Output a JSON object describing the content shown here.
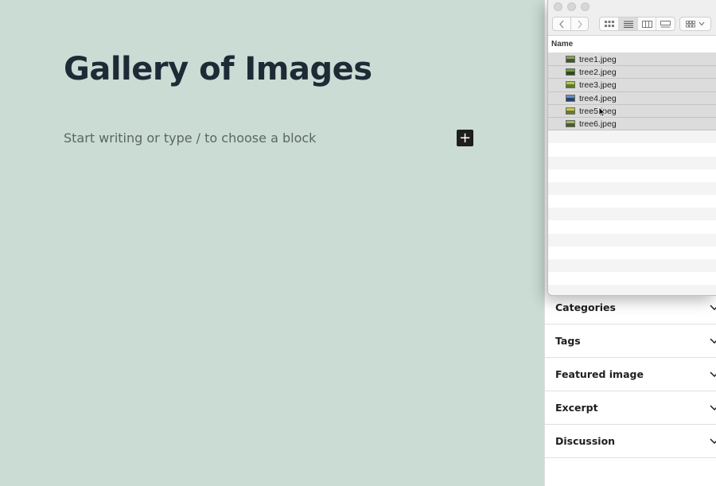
{
  "editor": {
    "post_title": "Gallery of Images",
    "block_placeholder": "Start writing or type / to choose a block",
    "add_block_symbol": "+"
  },
  "sidebar": {
    "panels": [
      {
        "label": "Categories"
      },
      {
        "label": "Tags"
      },
      {
        "label": "Featured image"
      },
      {
        "label": "Excerpt"
      },
      {
        "label": "Discussion"
      }
    ]
  },
  "finder": {
    "column_header": "Name",
    "files": [
      {
        "name": "tree1.jpeg",
        "selected": true,
        "icon": "image-thumbnail-icon",
        "thumb_colors": [
          "#8aa05a",
          "#3d5a2a"
        ]
      },
      {
        "name": "tree2.jpeg",
        "selected": true,
        "icon": "image-thumbnail-icon",
        "thumb_colors": [
          "#6e9a3c",
          "#2f4a1e"
        ]
      },
      {
        "name": "tree3.jpeg",
        "selected": true,
        "icon": "image-thumbnail-icon",
        "thumb_colors": [
          "#b5c94a",
          "#5c7a2a"
        ]
      },
      {
        "name": "tree4.jpeg",
        "selected": true,
        "icon": "image-thumbnail-icon",
        "thumb_colors": [
          "#6a8fc0",
          "#2a3f6a"
        ]
      },
      {
        "name": "tree5.jpeg",
        "selected": true,
        "icon": "image-thumbnail-icon",
        "thumb_colors": [
          "#c8c84a",
          "#6a7a2a"
        ]
      },
      {
        "name": "tree6.jpeg",
        "selected": true,
        "icon": "image-thumbnail-icon",
        "thumb_colors": [
          "#a0b85a",
          "#4a5e2a"
        ]
      }
    ],
    "empty_rows": 13
  },
  "colors": {
    "canvas_bg": "#cadcd4",
    "title_text": "#1e2a35",
    "selection_bg": "#dcdcdc"
  }
}
